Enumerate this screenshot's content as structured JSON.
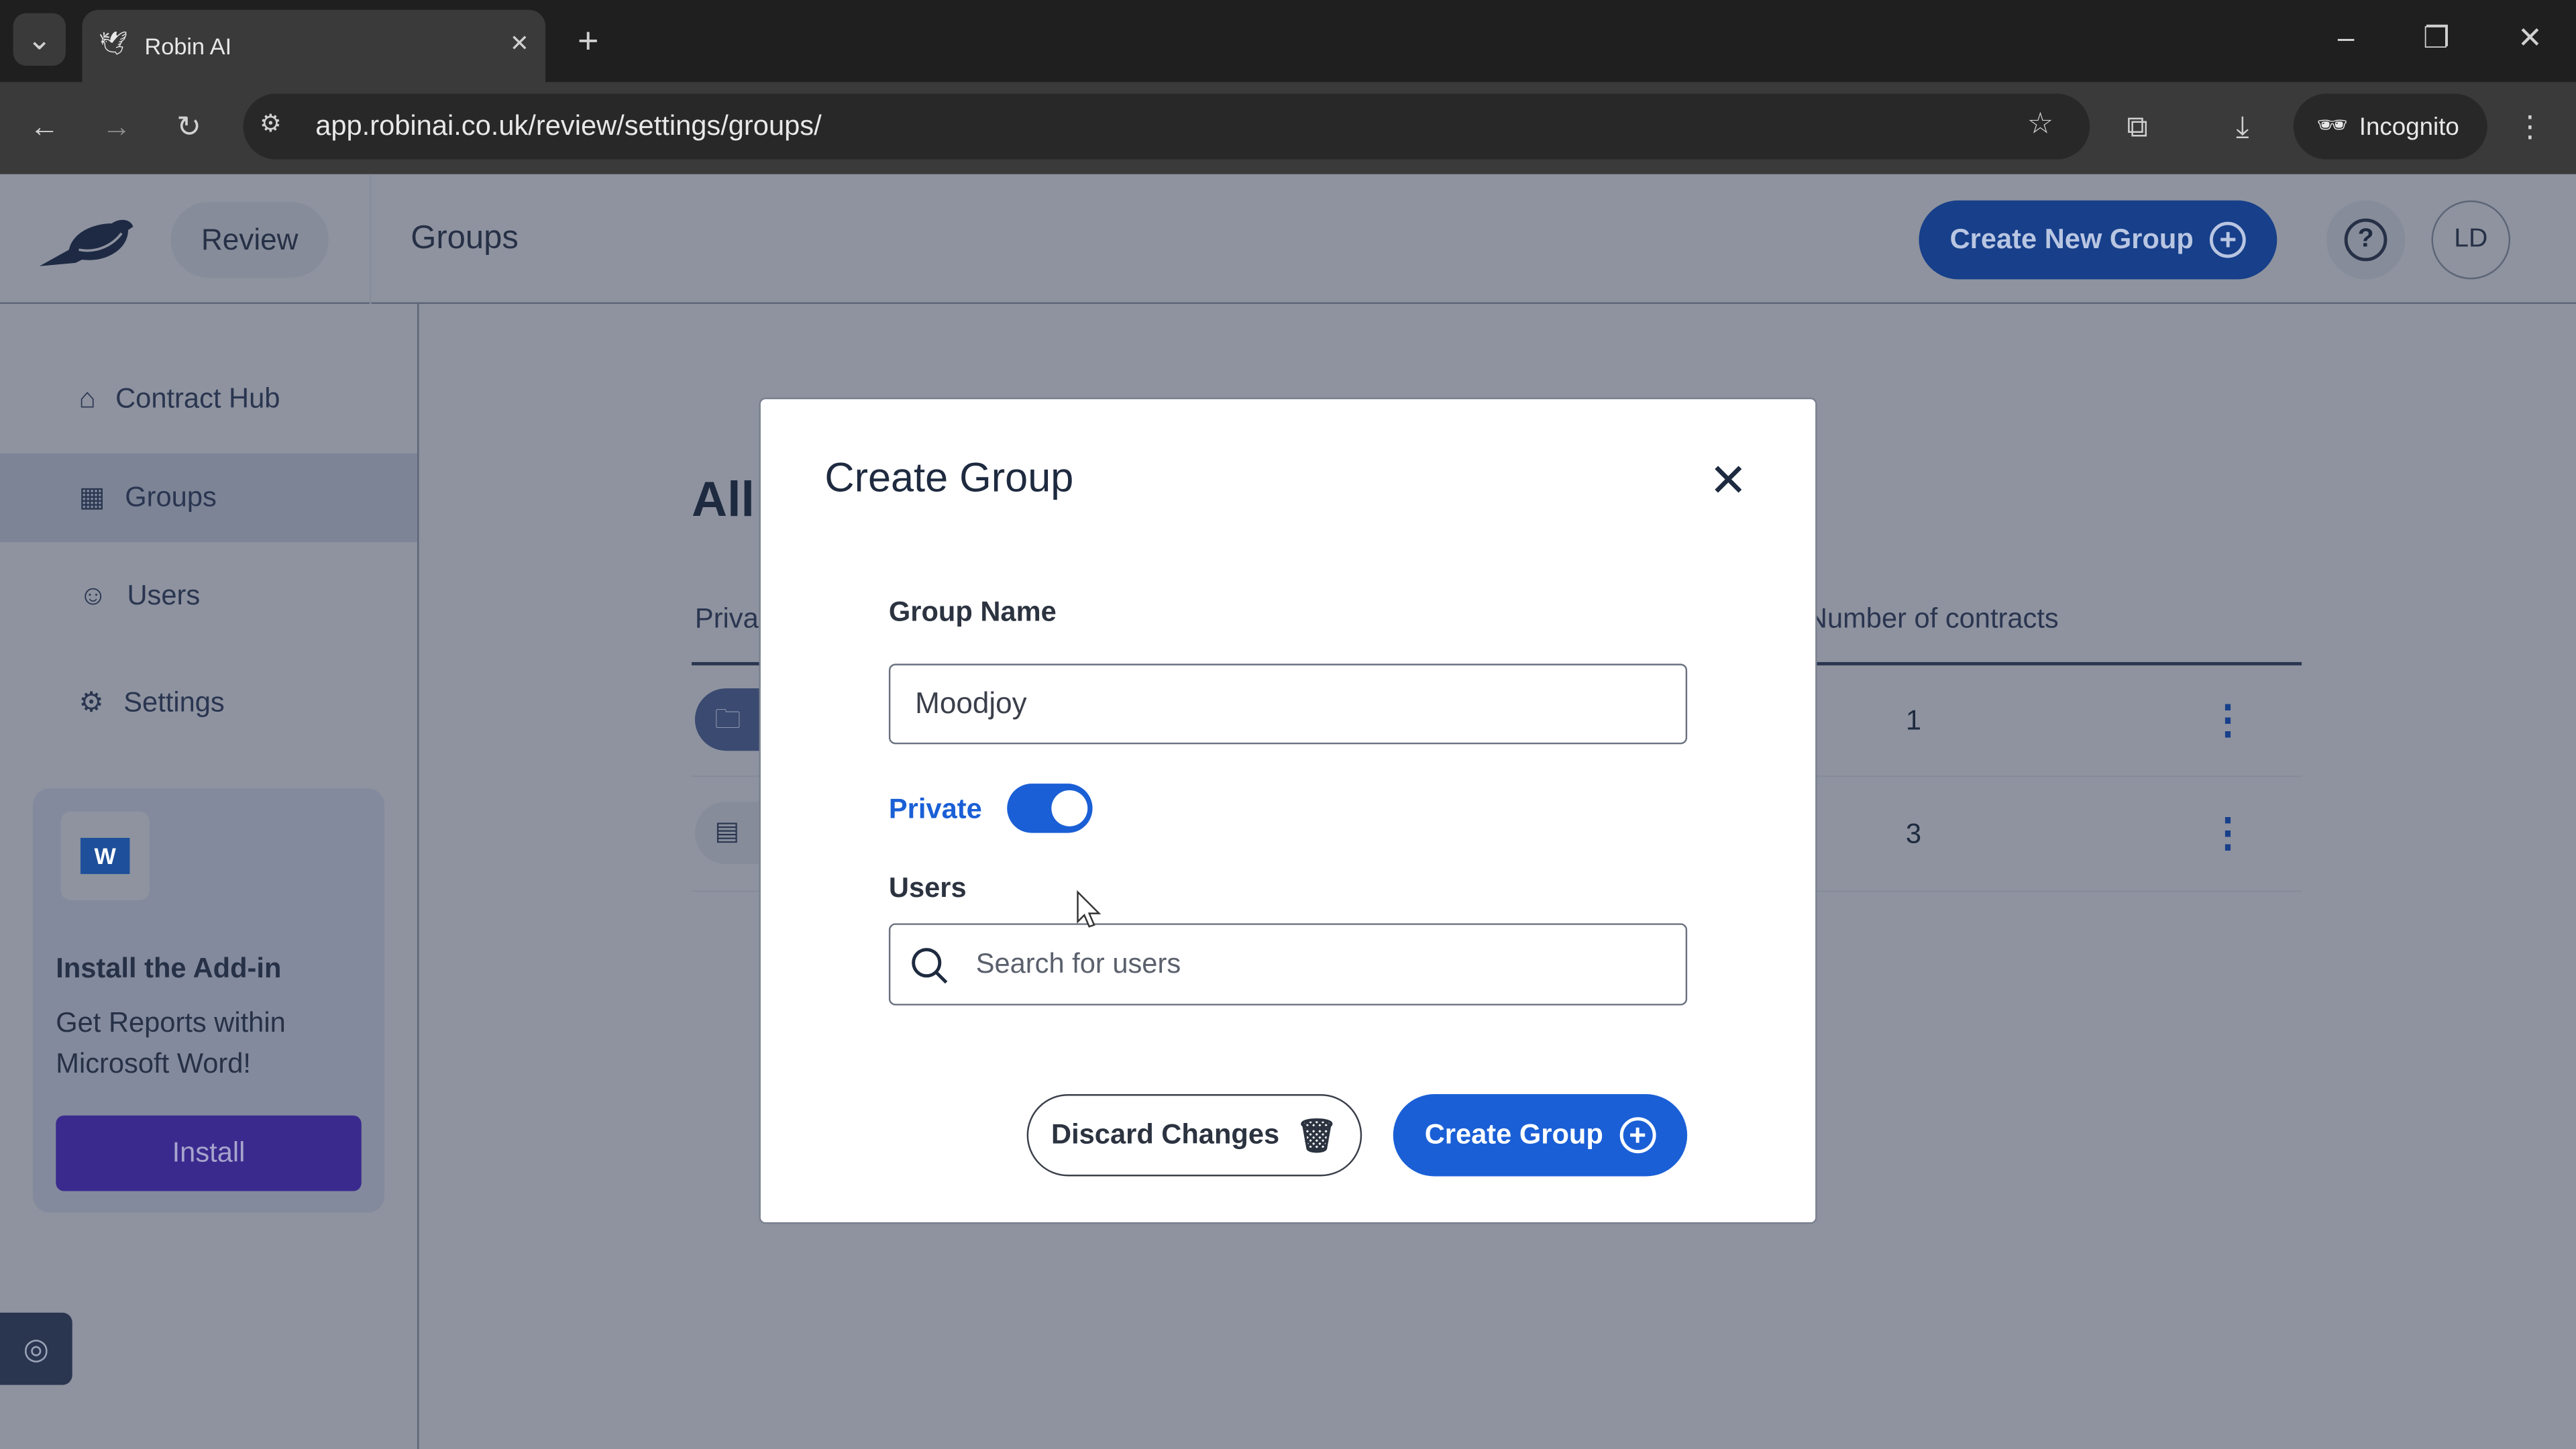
{
  "browser": {
    "tab_title": "Robin AI",
    "url": "app.robinai.co.uk/review/settings/groups/",
    "incognito_label": "Incognito"
  },
  "header": {
    "review_label": "Review",
    "page_title": "Groups",
    "create_new_group_label": "Create New Group",
    "avatar_initials": "LD"
  },
  "sidebar": {
    "items": [
      {
        "label": "Contract Hub",
        "icon": "home-icon"
      },
      {
        "label": "Groups",
        "icon": "grid-icon"
      },
      {
        "label": "Users",
        "icon": "user-icon"
      },
      {
        "label": "Settings",
        "icon": "gear-icon"
      }
    ],
    "addin": {
      "title": "Install the Add-in",
      "text": "Get Reports within Microsoft Word!",
      "button": "Install"
    }
  },
  "main": {
    "heading_partial": "All",
    "col_private_partial": "Priva",
    "col_contracts": "Number of contracts",
    "rows": [
      {
        "contracts": "1"
      },
      {
        "contracts": "3"
      }
    ]
  },
  "modal": {
    "title": "Create Group",
    "group_name_label": "Group Name",
    "group_name_value": "Moodjoy",
    "private_label": "Private",
    "private_on": true,
    "users_label": "Users",
    "users_placeholder": "Search for users",
    "discard_label": "Discard Changes",
    "create_label": "Create Group"
  },
  "colors": {
    "primary": "#1a5fd6",
    "install": "#4a2fb5",
    "overlay": "#8e939f"
  }
}
